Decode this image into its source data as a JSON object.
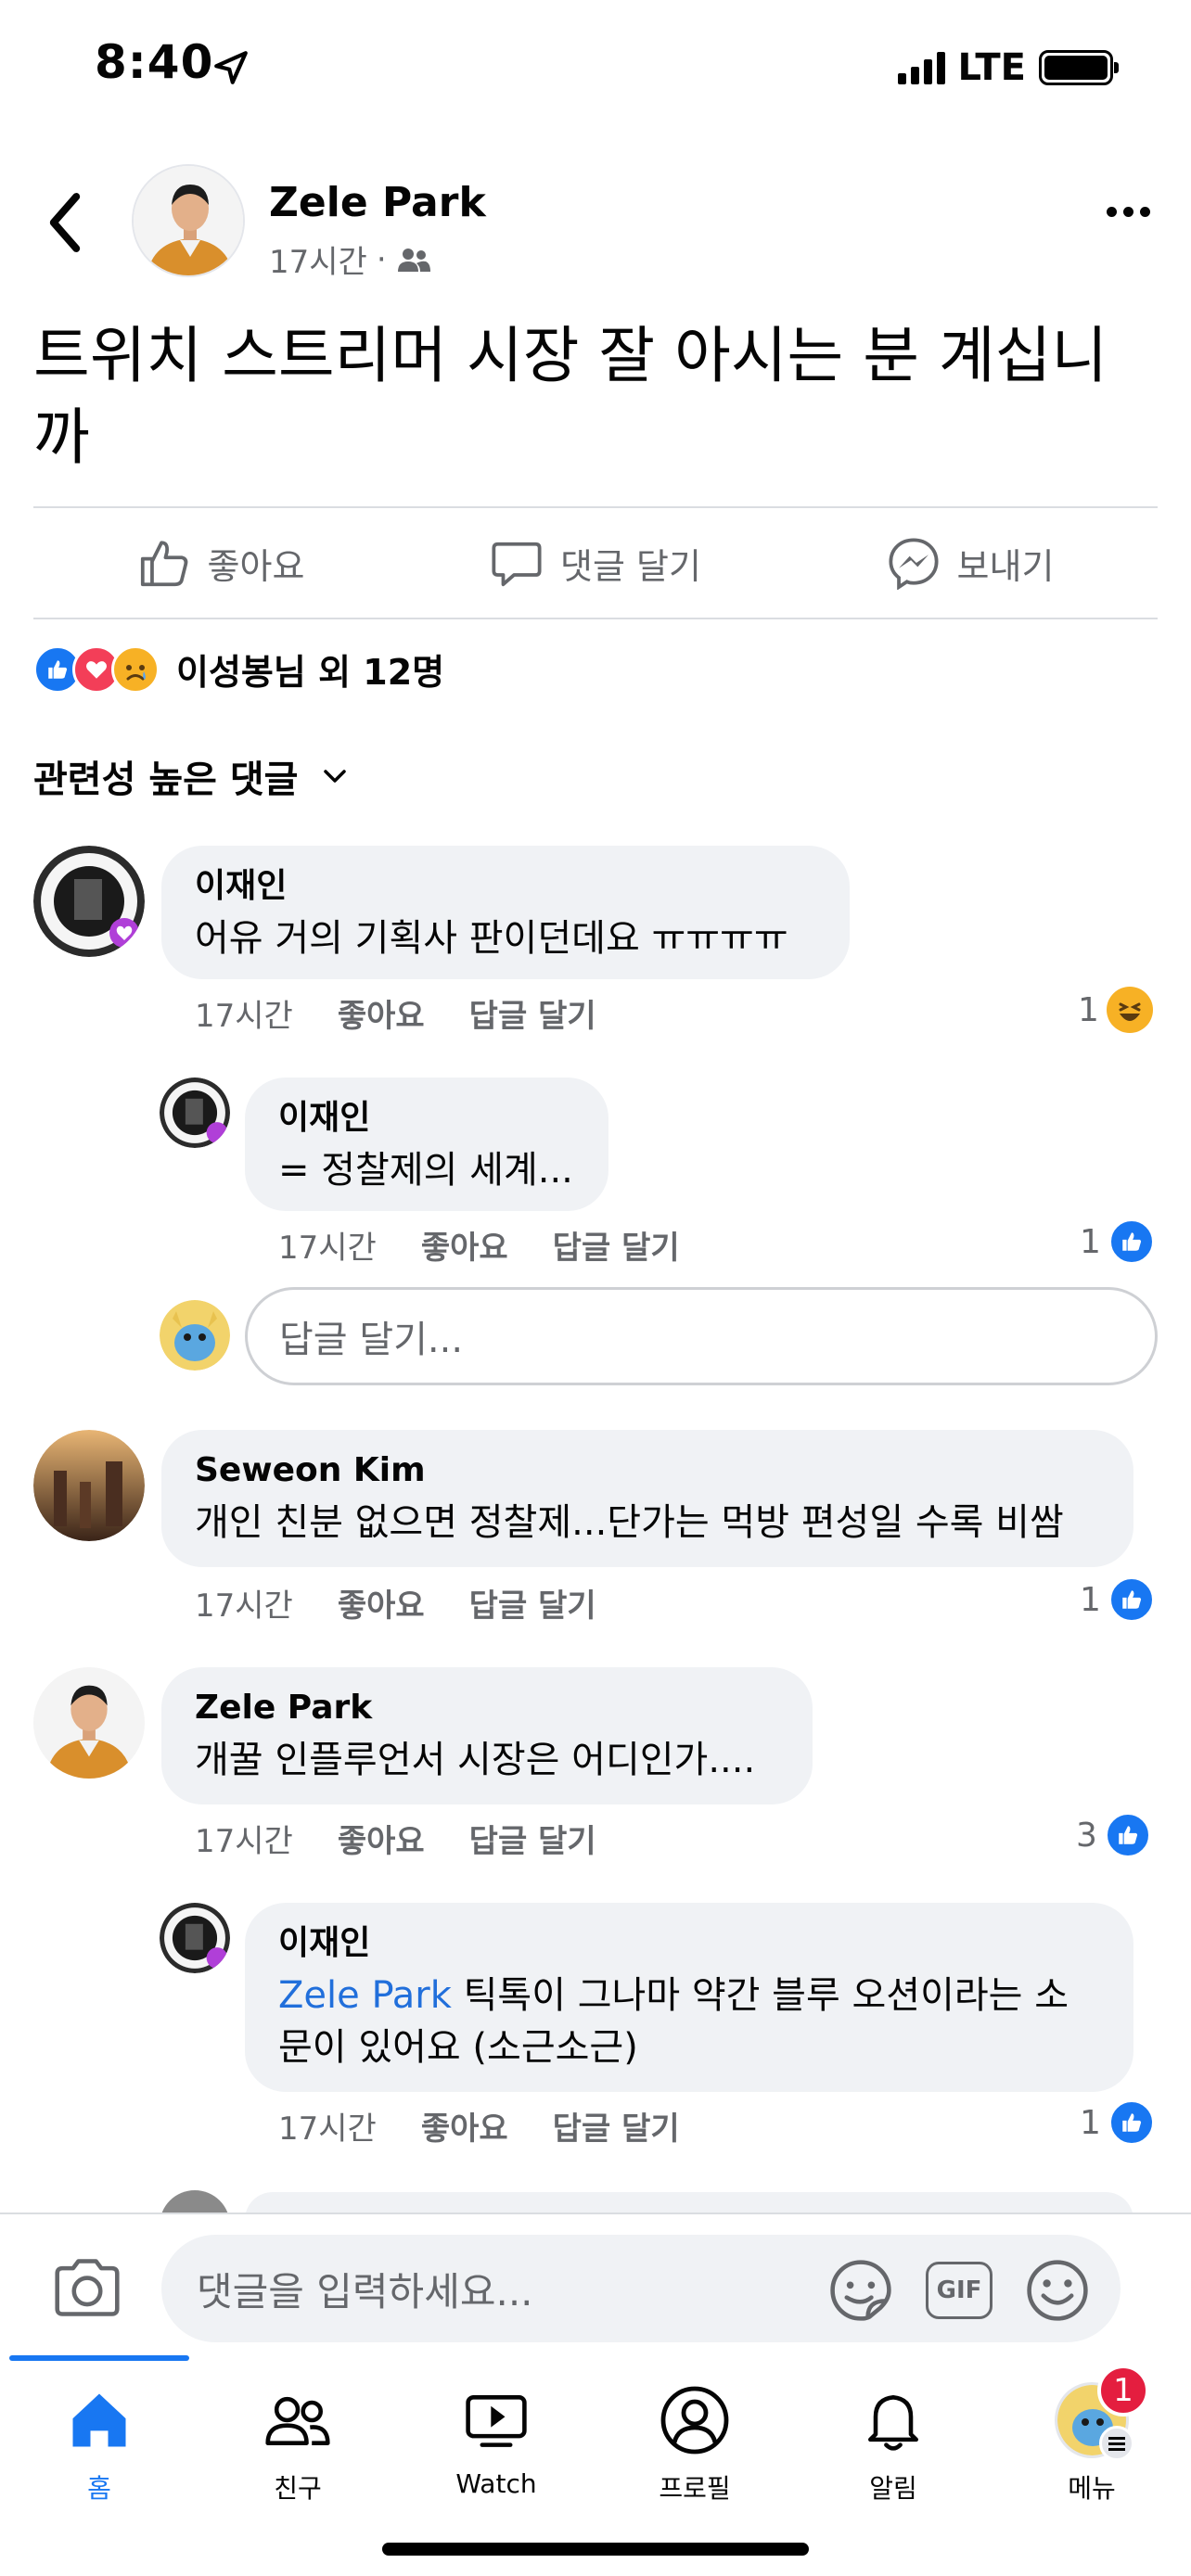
{
  "status_bar": {
    "time": "8:40",
    "network": "LTE"
  },
  "post": {
    "author": "Zele Park",
    "time": "17시간",
    "meta_sep": "·",
    "text": "트위치 스트리머 시장 잘 아시는 분 계십니까",
    "actions": {
      "like": "좋아요",
      "comment": "댓글 달기",
      "share": "보내기"
    },
    "reactions_text": "이성봉님 외 12명"
  },
  "comments_header": {
    "sort_label": "관련성 높은 댓글"
  },
  "comments": [
    {
      "name": "이재인",
      "text": "어유 거의 기획사 판이던데요 ㅠㅠㅠㅠ",
      "time": "17시간",
      "like": "좋아요",
      "reply": "답글 달기",
      "count": "1"
    },
    {
      "name": "이재인",
      "text": "= 정찰제의 세계...",
      "time": "17시간",
      "like": "좋아요",
      "reply": "답글 달기",
      "count": "1"
    },
    {
      "name": "Seweon Kim",
      "text": "개인 친분 없으면 정찰제...단가는 먹방 편성일 수록 비쌈",
      "time": "17시간",
      "like": "좋아요",
      "reply": "답글 달기",
      "count": "1"
    },
    {
      "name": "Zele Park",
      "text": "개꿀 인플루언서 시장은 어디인가....",
      "time": "17시간",
      "like": "좋아요",
      "reply": "답글 달기",
      "count": "3"
    },
    {
      "name": "이재인",
      "mention": "Zele Park",
      "text": " 틱톡이 그나마 약간 블루 오션이라는 소문이 있어요 (소근소근)",
      "time": "17시간",
      "like": "좋아요",
      "reply": "답글 달기",
      "count": "1"
    }
  ],
  "reply_input": {
    "placeholder": "답글 달기..."
  },
  "comment_bar": {
    "placeholder": "댓글을 입력하세요...",
    "gif": "GIF"
  },
  "tabs": [
    {
      "label": "홈",
      "icon": "home-icon"
    },
    {
      "label": "친구",
      "icon": "friends-icon"
    },
    {
      "label": "Watch",
      "icon": "watch-icon"
    },
    {
      "label": "프로필",
      "icon": "profile-icon"
    },
    {
      "label": "알림",
      "icon": "bell-icon"
    },
    {
      "label": "메뉴",
      "icon": "menu-icon",
      "badge": "1"
    }
  ],
  "colors": {
    "accent": "#1877f2",
    "bubble": "#f0f2f5",
    "muted": "#65676b",
    "badge": "#e41e3f",
    "mention": "#216fdb"
  }
}
